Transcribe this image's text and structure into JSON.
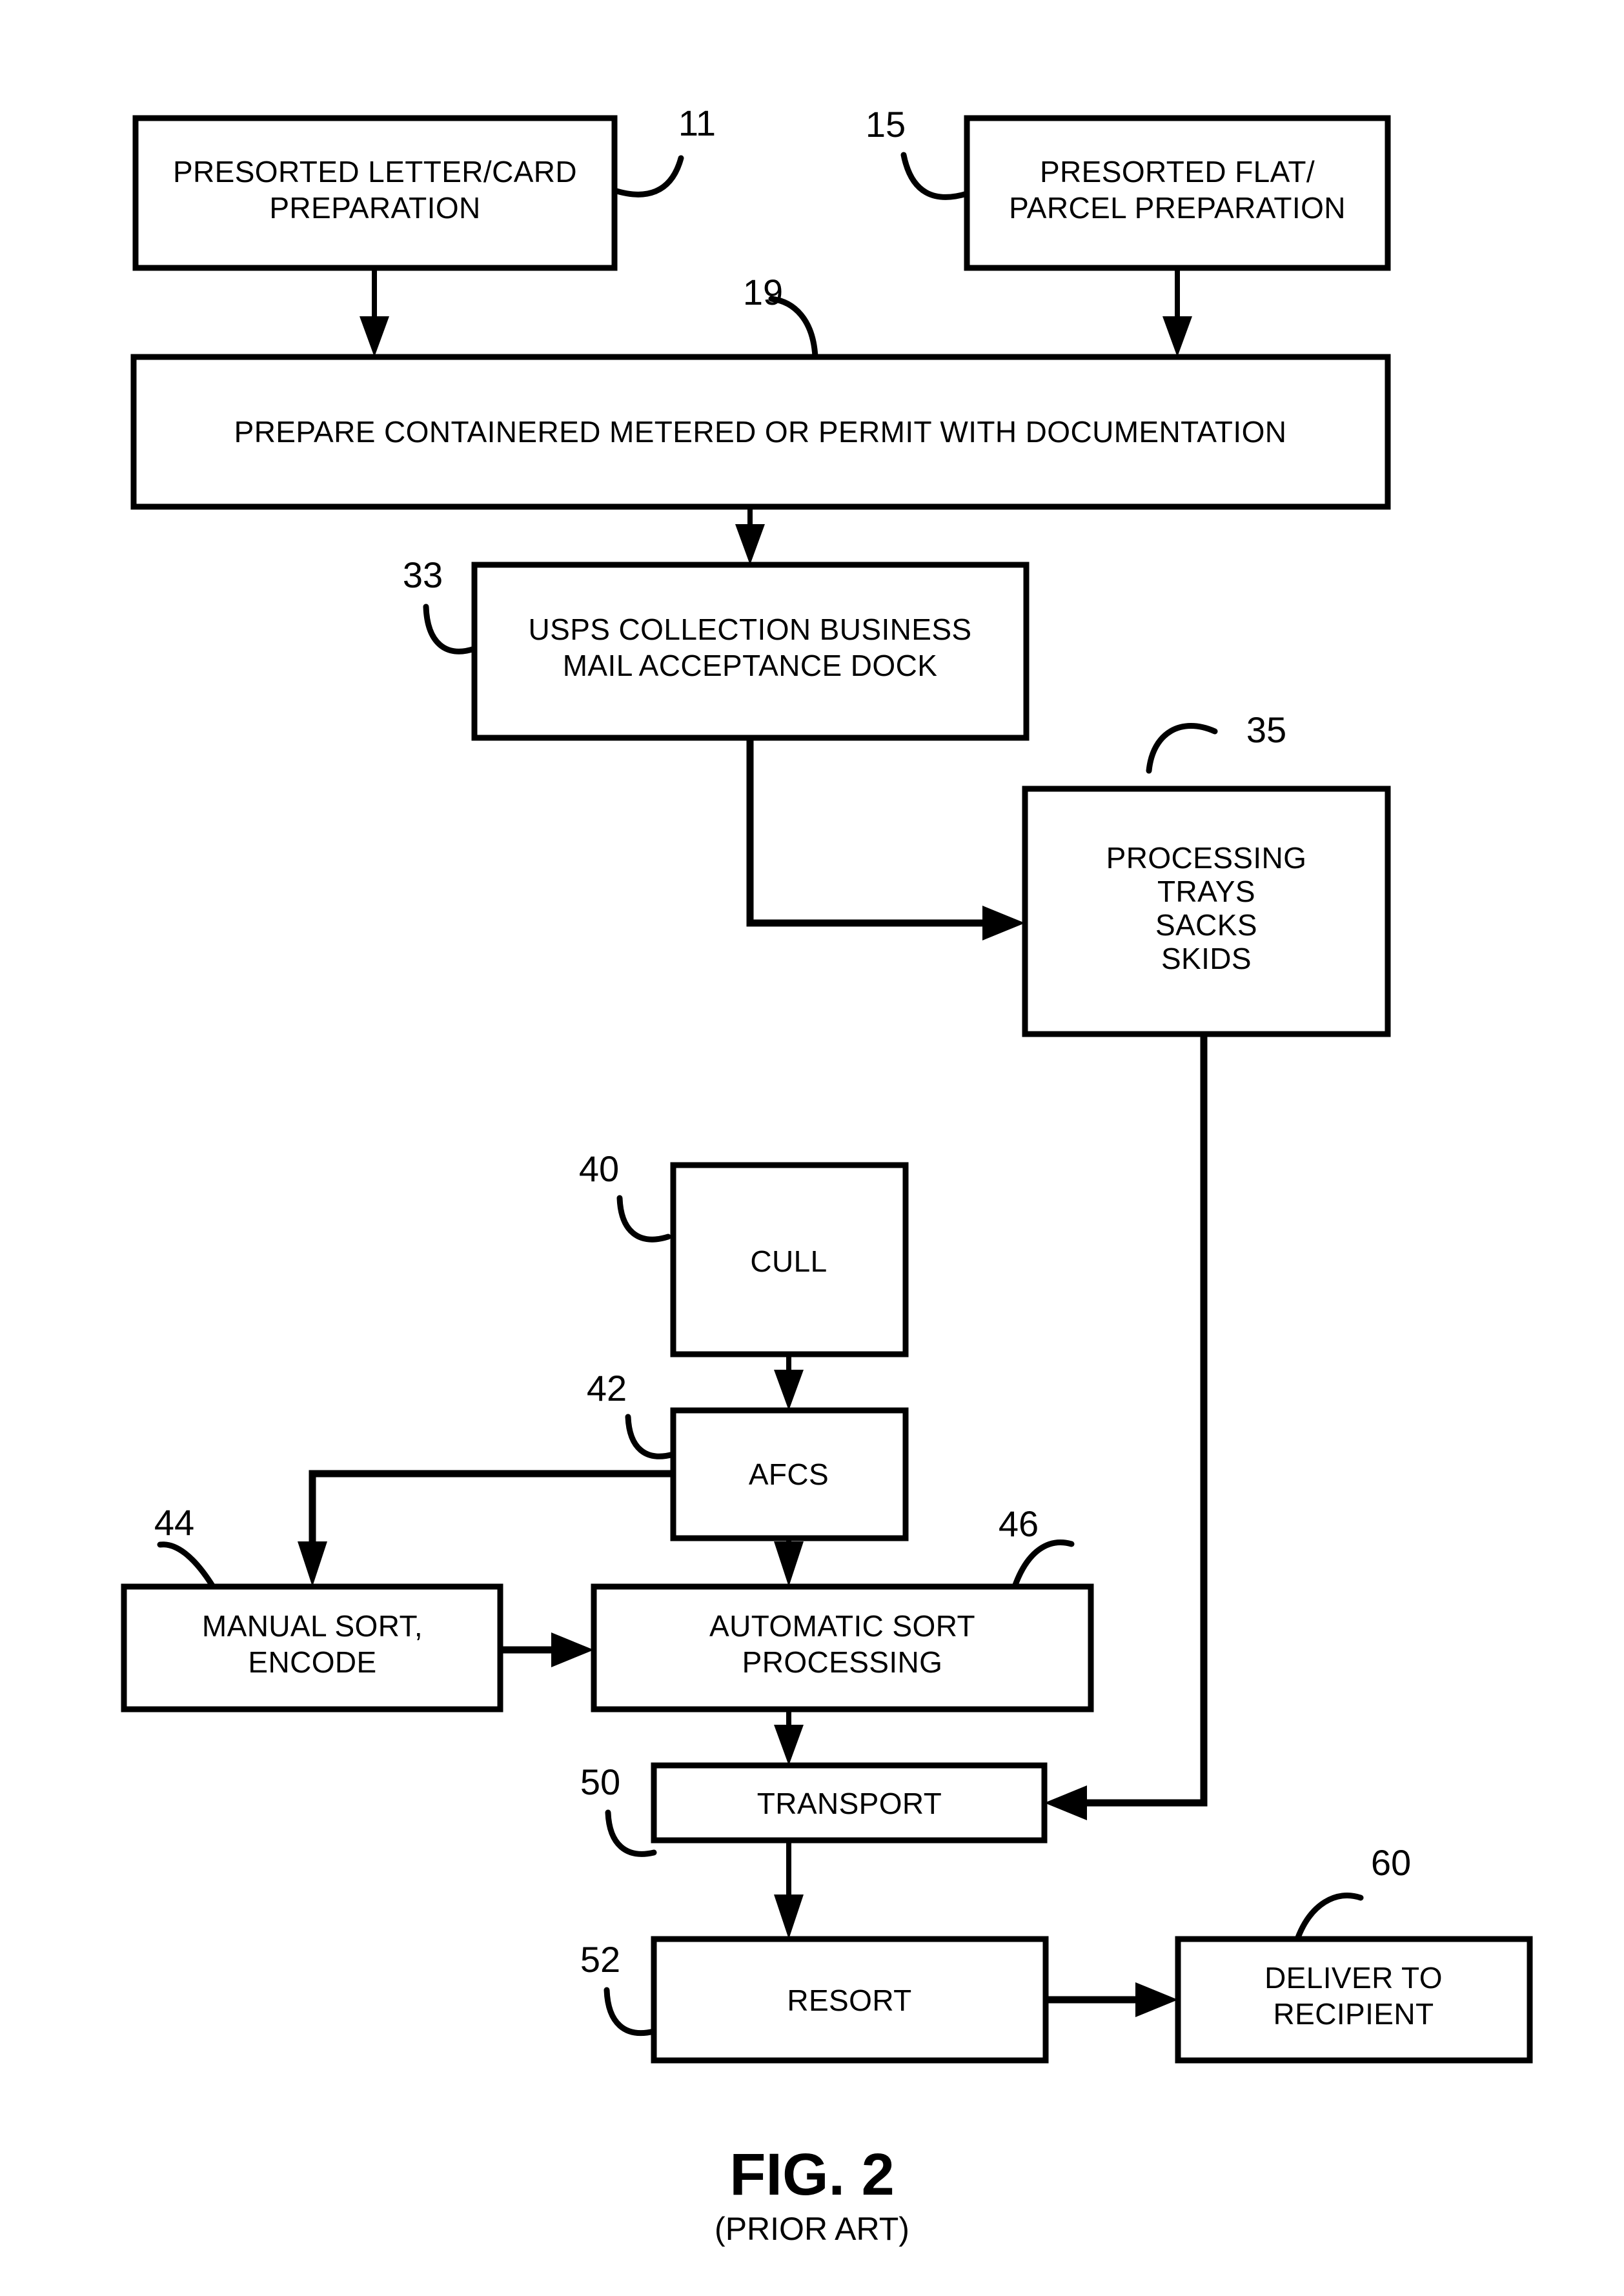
{
  "figure": {
    "title": "FIG. 2",
    "subtitle": "(PRIOR ART)",
    "type": "patent-flowchart"
  },
  "nodes": {
    "presorted_letter_card": {
      "ref": "11",
      "line1": "PRESORTED LETTER/CARD",
      "line2": "PREPARATION"
    },
    "presorted_flat_parcel": {
      "ref": "15",
      "line1": "PRESORTED FLAT/",
      "line2": "PARCEL PREPARATION"
    },
    "prepare_containered": {
      "ref": "19",
      "line1": "PREPARE CONTAINERED METERED OR PERMIT WITH DOCUMENTATION"
    },
    "usps_collection": {
      "ref": "33",
      "line1": "USPS COLLECTION BUSINESS",
      "line2": "MAIL ACCEPTANCE DOCK"
    },
    "processing_containers": {
      "ref": "35",
      "line1": "PROCESSING",
      "line2": "TRAYS",
      "line3": "SACKS",
      "line4": "SKIDS"
    },
    "cull": {
      "ref": "40",
      "line1": "CULL"
    },
    "afcs": {
      "ref": "42",
      "line1": "AFCS"
    },
    "manual_sort": {
      "ref": "44",
      "line1": "MANUAL SORT,",
      "line2": "ENCODE"
    },
    "automatic_sort": {
      "ref": "46",
      "line1": "AUTOMATIC SORT",
      "line2": "PROCESSING"
    },
    "transport": {
      "ref": "50",
      "line1": "TRANSPORT"
    },
    "resort": {
      "ref": "52",
      "line1": "RESORT"
    },
    "deliver": {
      "ref": "60",
      "line1": "DELIVER TO",
      "line2": "RECIPIENT"
    }
  },
  "colors": {
    "ink": "#000000",
    "paper": "#ffffff"
  },
  "chart_data": {
    "type": "diagram",
    "title": "FIG. 2 (PRIOR ART)",
    "nodes": [
      {
        "ref": "11",
        "label": "PRESORTED LETTER/CARD PREPARATION"
      },
      {
        "ref": "15",
        "label": "PRESORTED FLAT/ PARCEL PREPARATION"
      },
      {
        "ref": "19",
        "label": "PREPARE CONTAINERED METERED OR PERMIT WITH DOCUMENTATION"
      },
      {
        "ref": "33",
        "label": "USPS COLLECTION BUSINESS MAIL ACCEPTANCE DOCK"
      },
      {
        "ref": "35",
        "label": "PROCESSING TRAYS SACKS SKIDS"
      },
      {
        "ref": "40",
        "label": "CULL"
      },
      {
        "ref": "42",
        "label": "AFCS"
      },
      {
        "ref": "44",
        "label": "MANUAL SORT, ENCODE"
      },
      {
        "ref": "46",
        "label": "AUTOMATIC SORT PROCESSING"
      },
      {
        "ref": "50",
        "label": "TRANSPORT"
      },
      {
        "ref": "52",
        "label": "RESORT"
      },
      {
        "ref": "60",
        "label": "DELIVER TO RECIPIENT"
      }
    ],
    "edges": [
      {
        "from": "11",
        "to": "19"
      },
      {
        "from": "15",
        "to": "19"
      },
      {
        "from": "19",
        "to": "33"
      },
      {
        "from": "33",
        "to": "35"
      },
      {
        "from": "35",
        "to": "50"
      },
      {
        "from": "40",
        "to": "42"
      },
      {
        "from": "42",
        "to": "44"
      },
      {
        "from": "42",
        "to": "46"
      },
      {
        "from": "44",
        "to": "46"
      },
      {
        "from": "46",
        "to": "50"
      },
      {
        "from": "50",
        "to": "52"
      },
      {
        "from": "52",
        "to": "60"
      }
    ]
  }
}
